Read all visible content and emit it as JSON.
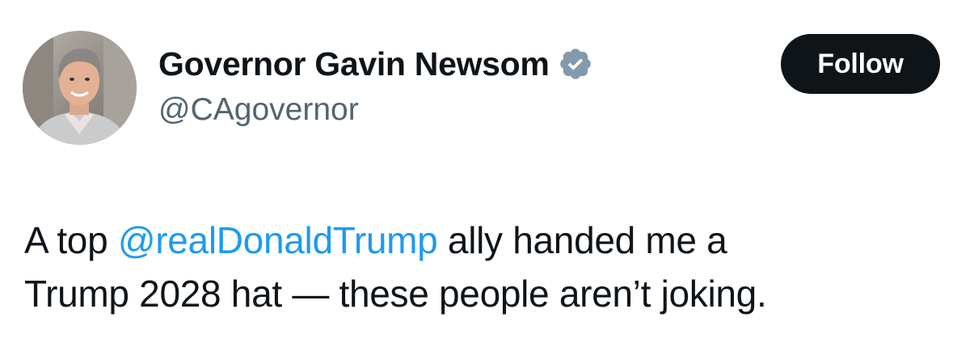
{
  "author": {
    "display_name": "Governor Gavin Newsom",
    "handle": "@CAgovernor",
    "verified_icon": "verified-badge-icon",
    "verified_color": "#829aab"
  },
  "follow_button": {
    "label": "Follow",
    "bg_color": "#0f1419"
  },
  "tweet": {
    "text_before_mention": "A top ",
    "mention": "@realDonaldTrump",
    "text_after_mention": " ally handed me a",
    "line2": "Trump 2028 hat — these people aren’t joking.",
    "mention_color": "#1d9bf0"
  }
}
